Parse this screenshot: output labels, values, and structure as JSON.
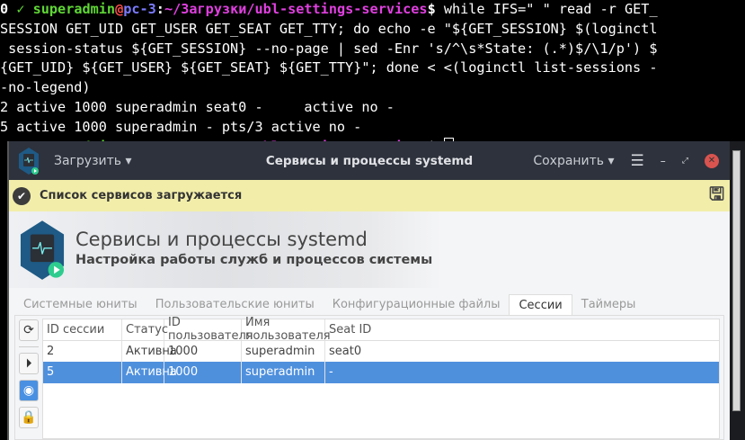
{
  "terminal": {
    "prompt": {
      "status": "0",
      "check": "✓",
      "user": "superadmin",
      "at": "@",
      "host": "pc-3",
      "colon": ":",
      "path": "~/Загрузки/ubl-settings-services",
      "dollar": "$"
    },
    "command_lines": [
      " while IFS=\" \" read -r GET_",
      "SESSION GET_UID GET_USER GET_SEAT GET_TTY; do echo -e \"${GET_SESSION} $(loginctl",
      " session-status ${GET_SESSION} --no-page | sed -Enr 's/^\\s*State: (.*)$/\\1/p') $",
      "{GET_UID} ${GET_USER} ${GET_SEAT} ${GET_TTY}\"; done < <(loginctl list-sessions -",
      "-no-legend)"
    ],
    "output_lines": [
      "2 active 1000 superadmin seat0 -     active no -",
      "5 active 1000 superadmin - pts/3 active no -"
    ]
  },
  "window": {
    "title": "Сервисы и процессы systemd",
    "load_menu": "Загрузить",
    "save_menu": "Сохранить",
    "notice": "Список сервисов загружается",
    "banner_title": "Сервисы и процессы systemd",
    "banner_subtitle": "Настройка работы служб и процессов системы",
    "tabs": [
      "Системные юниты",
      "Пользовательские юниты",
      "Конфигурационные файлы",
      "Сессии",
      "Таймеры"
    ],
    "table": {
      "headers": [
        "ID сессии",
        "Статус",
        "ID пользователя",
        "Имя пользователя",
        "Seat ID"
      ],
      "rows": [
        [
          "2",
          "Активна",
          "1000",
          "superadmin",
          "seat0"
        ],
        [
          "5",
          "Активна",
          "1000",
          "superadmin",
          "-"
        ]
      ]
    }
  },
  "colors": {
    "accent": "#4f90dd",
    "notice_bg": "#f2eeaa",
    "titlebar": "#2e323c"
  }
}
